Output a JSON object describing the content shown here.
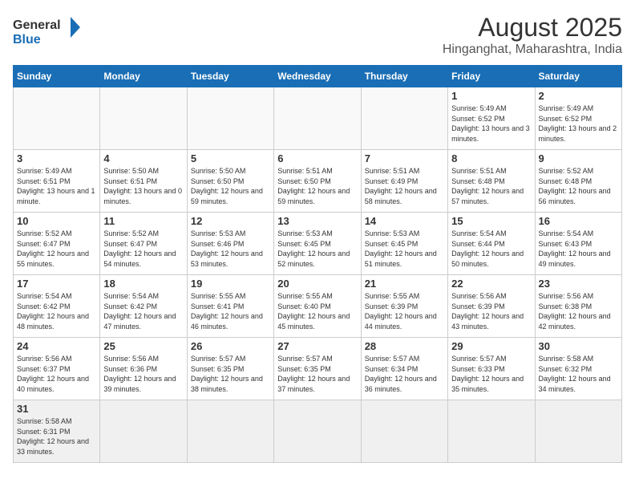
{
  "header": {
    "logo_general": "General",
    "logo_blue": "Blue",
    "title": "August 2025",
    "subtitle": "Hinganghat, Maharashtra, India"
  },
  "days_of_week": [
    "Sunday",
    "Monday",
    "Tuesday",
    "Wednesday",
    "Thursday",
    "Friday",
    "Saturday"
  ],
  "weeks": [
    {
      "days": [
        {
          "num": "",
          "info": ""
        },
        {
          "num": "",
          "info": ""
        },
        {
          "num": "",
          "info": ""
        },
        {
          "num": "",
          "info": ""
        },
        {
          "num": "",
          "info": ""
        },
        {
          "num": "1",
          "info": "Sunrise: 5:49 AM\nSunset: 6:52 PM\nDaylight: 13 hours\nand 3 minutes."
        },
        {
          "num": "2",
          "info": "Sunrise: 5:49 AM\nSunset: 6:52 PM\nDaylight: 13 hours\nand 2 minutes."
        }
      ]
    },
    {
      "days": [
        {
          "num": "3",
          "info": "Sunrise: 5:49 AM\nSunset: 6:51 PM\nDaylight: 13 hours\nand 1 minute."
        },
        {
          "num": "4",
          "info": "Sunrise: 5:50 AM\nSunset: 6:51 PM\nDaylight: 13 hours\nand 0 minutes."
        },
        {
          "num": "5",
          "info": "Sunrise: 5:50 AM\nSunset: 6:50 PM\nDaylight: 12 hours\nand 59 minutes."
        },
        {
          "num": "6",
          "info": "Sunrise: 5:51 AM\nSunset: 6:50 PM\nDaylight: 12 hours\nand 59 minutes."
        },
        {
          "num": "7",
          "info": "Sunrise: 5:51 AM\nSunset: 6:49 PM\nDaylight: 12 hours\nand 58 minutes."
        },
        {
          "num": "8",
          "info": "Sunrise: 5:51 AM\nSunset: 6:48 PM\nDaylight: 12 hours\nand 57 minutes."
        },
        {
          "num": "9",
          "info": "Sunrise: 5:52 AM\nSunset: 6:48 PM\nDaylight: 12 hours\nand 56 minutes."
        }
      ]
    },
    {
      "days": [
        {
          "num": "10",
          "info": "Sunrise: 5:52 AM\nSunset: 6:47 PM\nDaylight: 12 hours\nand 55 minutes."
        },
        {
          "num": "11",
          "info": "Sunrise: 5:52 AM\nSunset: 6:47 PM\nDaylight: 12 hours\nand 54 minutes."
        },
        {
          "num": "12",
          "info": "Sunrise: 5:53 AM\nSunset: 6:46 PM\nDaylight: 12 hours\nand 53 minutes."
        },
        {
          "num": "13",
          "info": "Sunrise: 5:53 AM\nSunset: 6:45 PM\nDaylight: 12 hours\nand 52 minutes."
        },
        {
          "num": "14",
          "info": "Sunrise: 5:53 AM\nSunset: 6:45 PM\nDaylight: 12 hours\nand 51 minutes."
        },
        {
          "num": "15",
          "info": "Sunrise: 5:54 AM\nSunset: 6:44 PM\nDaylight: 12 hours\nand 50 minutes."
        },
        {
          "num": "16",
          "info": "Sunrise: 5:54 AM\nSunset: 6:43 PM\nDaylight: 12 hours\nand 49 minutes."
        }
      ]
    },
    {
      "days": [
        {
          "num": "17",
          "info": "Sunrise: 5:54 AM\nSunset: 6:42 PM\nDaylight: 12 hours\nand 48 minutes."
        },
        {
          "num": "18",
          "info": "Sunrise: 5:54 AM\nSunset: 6:42 PM\nDaylight: 12 hours\nand 47 minutes."
        },
        {
          "num": "19",
          "info": "Sunrise: 5:55 AM\nSunset: 6:41 PM\nDaylight: 12 hours\nand 46 minutes."
        },
        {
          "num": "20",
          "info": "Sunrise: 5:55 AM\nSunset: 6:40 PM\nDaylight: 12 hours\nand 45 minutes."
        },
        {
          "num": "21",
          "info": "Sunrise: 5:55 AM\nSunset: 6:39 PM\nDaylight: 12 hours\nand 44 minutes."
        },
        {
          "num": "22",
          "info": "Sunrise: 5:56 AM\nSunset: 6:39 PM\nDaylight: 12 hours\nand 43 minutes."
        },
        {
          "num": "23",
          "info": "Sunrise: 5:56 AM\nSunset: 6:38 PM\nDaylight: 12 hours\nand 42 minutes."
        }
      ]
    },
    {
      "days": [
        {
          "num": "24",
          "info": "Sunrise: 5:56 AM\nSunset: 6:37 PM\nDaylight: 12 hours\nand 40 minutes."
        },
        {
          "num": "25",
          "info": "Sunrise: 5:56 AM\nSunset: 6:36 PM\nDaylight: 12 hours\nand 39 minutes."
        },
        {
          "num": "26",
          "info": "Sunrise: 5:57 AM\nSunset: 6:35 PM\nDaylight: 12 hours\nand 38 minutes."
        },
        {
          "num": "27",
          "info": "Sunrise: 5:57 AM\nSunset: 6:35 PM\nDaylight: 12 hours\nand 37 minutes."
        },
        {
          "num": "28",
          "info": "Sunrise: 5:57 AM\nSunset: 6:34 PM\nDaylight: 12 hours\nand 36 minutes."
        },
        {
          "num": "29",
          "info": "Sunrise: 5:57 AM\nSunset: 6:33 PM\nDaylight: 12 hours\nand 35 minutes."
        },
        {
          "num": "30",
          "info": "Sunrise: 5:58 AM\nSunset: 6:32 PM\nDaylight: 12 hours\nand 34 minutes."
        }
      ]
    },
    {
      "days": [
        {
          "num": "31",
          "info": "Sunrise: 5:58 AM\nSunset: 6:31 PM\nDaylight: 12 hours\nand 33 minutes."
        },
        {
          "num": "",
          "info": ""
        },
        {
          "num": "",
          "info": ""
        },
        {
          "num": "",
          "info": ""
        },
        {
          "num": "",
          "info": ""
        },
        {
          "num": "",
          "info": ""
        },
        {
          "num": "",
          "info": ""
        }
      ]
    }
  ]
}
